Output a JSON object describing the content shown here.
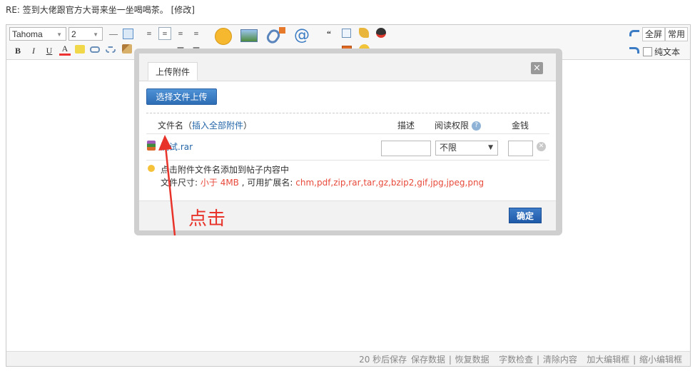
{
  "post_title": {
    "text": "RE: 签到大佬跟官方大哥来坐一坐喝喝茶。",
    "edit_link": "[修改]"
  },
  "toolbar": {
    "font_family": "Tahoma",
    "font_size": "2",
    "formatting": [
      "B",
      "I",
      "U",
      "A"
    ],
    "insert_labels": {
      "emoji": "表情",
      "image": "图片",
      "attachment": "附件",
      "mention": "@朋"
    },
    "fullscreen_label": "全屏",
    "common_label": "常用",
    "plain_text_label": "纯文本"
  },
  "status_bar": {
    "autosave": "20 秒后保存",
    "items": [
      "保存数据",
      "恢复数据",
      "字数检查",
      "清除内容",
      "加大编辑框",
      "缩小编辑框"
    ]
  },
  "upload_dialog": {
    "tab_label": "上传附件",
    "close_glyph": "×",
    "upload_button": "选择文件上传",
    "columns": {
      "filename": "文件名",
      "insert_all_link": "插入全部附件",
      "description": "描述",
      "permission": "阅读权限",
      "price": "金钱"
    },
    "file": {
      "name": "测试.rar",
      "permission_value": "不限"
    },
    "tip_line1": "点击附件文件名添加到帖子内容中",
    "tip_size_label": "文件尺寸:",
    "tip_size_value": "小于 4MB",
    "tip_ext_label": ", 可用扩展名:",
    "tip_ext_value": "chm,pdf,zip,rar,tar,gz,bzip2,gif,jpg,jpeg,png",
    "confirm_button": "确定"
  },
  "annotation": {
    "text": "点击",
    "color": "#e8332a"
  }
}
